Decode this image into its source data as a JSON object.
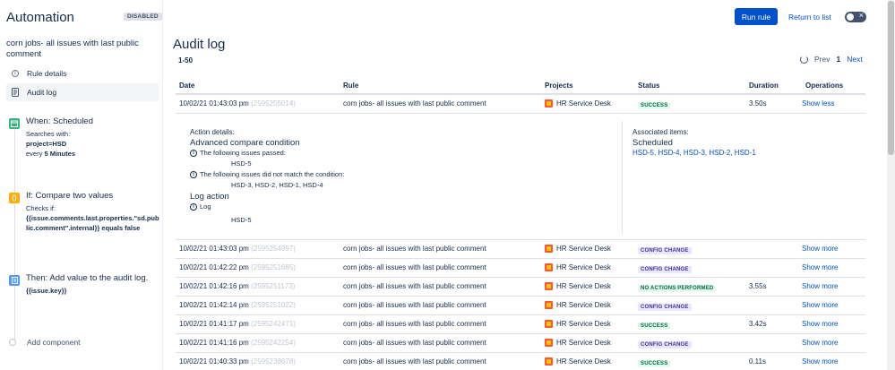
{
  "sidebar": {
    "app_title": "Automation",
    "status_badge": "DISABLED",
    "rule_name": "corn jobs- all issues with last public comment",
    "nav": [
      {
        "label": "Rule details",
        "icon": "info-icon"
      },
      {
        "label": "Audit log",
        "icon": "document-icon"
      }
    ],
    "steps": [
      {
        "title": "When: Scheduled",
        "line1": "Searches with:",
        "query_key": "project=HSD",
        "line3_prefix": "every ",
        "line3_bold": "5 Minutes",
        "icon": "calendar-icon",
        "color": "#36b37e"
      },
      {
        "title": "If: Compare two values",
        "line1": "Checks if:",
        "expression": "{{issue.comments.last.properties.\"sd.public.comment\".internal}} equals false",
        "icon": "braces-icon",
        "color": "#ffab00"
      },
      {
        "title": "Then: Add value to the audit log.",
        "value": "{{issue.key}}",
        "icon": "log-icon",
        "color": "#4c9aff"
      }
    ],
    "add_component": "Add component"
  },
  "header": {
    "run_rule": "Run rule",
    "return_to_list": "Return to list"
  },
  "main": {
    "title": "Audit log",
    "range": "1-50",
    "pager": {
      "prev": "Prev",
      "current": "1",
      "next": "Next"
    },
    "columns": [
      "Date",
      "Rule",
      "Projects",
      "Status",
      "Duration",
      "Operations"
    ],
    "first_row": {
      "date": "10/02/21 01:43:03 pm",
      "id": "(2595255014)",
      "rule": "corn jobs- all issues with last public comment",
      "project": "HR Service Desk",
      "status": "SUCCESS",
      "duration": "3.50s",
      "operation": "Show less"
    },
    "details": {
      "action_label": "Action details:",
      "condition_title": "Advanced compare condition",
      "passed_label": "The following issues passed:",
      "passed_issues": "HSD-5",
      "failed_label": "The following issues did not match the condition:",
      "failed_issues": "HSD-3, HSD-2, HSD-1, HSD-4",
      "log_title": "Log action",
      "log_label": "Log",
      "log_value": "HSD-5",
      "assoc_label": "Associated items:",
      "assoc_type": "Scheduled",
      "assoc_items": "HSD-5, HSD-4, HSD-3, HSD-2, HSD-1"
    },
    "rows": [
      {
        "date": "10/02/21 01:43:03 pm",
        "id": "(2595254997)",
        "rule": "corn jobs- all issues with last public comment",
        "project": "HR Service Desk",
        "status": "CONFIG CHANGE",
        "status_kind": "change",
        "duration": "",
        "operation": "Show more"
      },
      {
        "date": "10/02/21 01:42:22 pm",
        "id": "(2595251685)",
        "rule": "corn jobs- all issues with last public comment",
        "project": "HR Service Desk",
        "status": "CONFIG CHANGE",
        "status_kind": "change",
        "duration": "",
        "operation": "Show more"
      },
      {
        "date": "10/02/21 01:42:16 pm",
        "id": "(2595251173)",
        "rule": "corn jobs- all issues with last public comment",
        "project": "HR Service Desk",
        "status": "NO ACTIONS PERFORMED",
        "status_kind": "noaction",
        "duration": "3.55s",
        "operation": "Show more"
      },
      {
        "date": "10/02/21 01:42:14 pm",
        "id": "(2595251022)",
        "rule": "corn jobs- all issues with last public comment",
        "project": "HR Service Desk",
        "status": "CONFIG CHANGE",
        "status_kind": "change",
        "duration": "",
        "operation": "Show more"
      },
      {
        "date": "10/02/21 01:41:17 pm",
        "id": "(2595242471)",
        "rule": "corn jobs- all issues with last public comment",
        "project": "HR Service Desk",
        "status": "SUCCESS",
        "status_kind": "success",
        "duration": "3.42s",
        "operation": "Show more"
      },
      {
        "date": "10/02/21 01:41:16 pm",
        "id": "(2595242254)",
        "rule": "corn jobs- all issues with last public comment",
        "project": "HR Service Desk",
        "status": "CONFIG CHANGE",
        "status_kind": "change",
        "duration": "",
        "operation": "Show more"
      },
      {
        "date": "10/02/21 01:40:33 pm",
        "id": "(2595238678)",
        "rule": "corn jobs- all issues with last public comment",
        "project": "HR Service Desk",
        "status": "SUCCESS",
        "status_kind": "success",
        "duration": "0.11s",
        "operation": "Show more"
      }
    ]
  }
}
